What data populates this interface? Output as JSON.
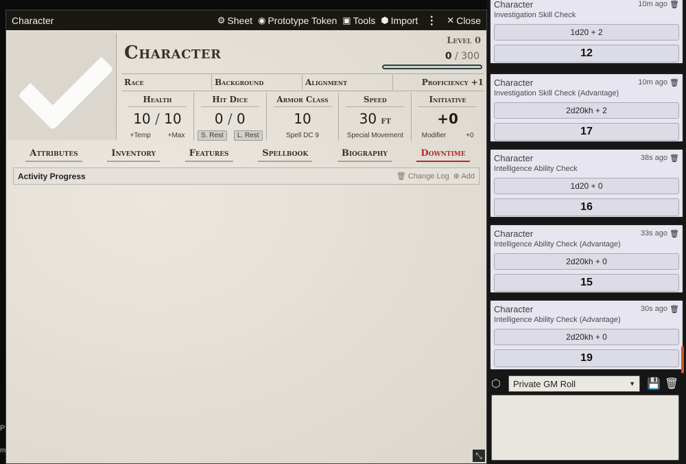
{
  "window": {
    "title": "Character",
    "buttons": [
      {
        "icon": "gear",
        "label": "Sheet"
      },
      {
        "icon": "user-circle",
        "label": "Prototype Token"
      },
      {
        "icon": "toolbox",
        "label": "Tools"
      },
      {
        "icon": "box",
        "label": "Import"
      }
    ],
    "close_label": "Close"
  },
  "character": {
    "name": "Character",
    "level_label": "Level 0",
    "xp_value": "0",
    "xp_max": "300",
    "race_label": "Race",
    "background_label": "Background",
    "alignment_label": "Alignment",
    "proficiency_label": "Proficiency +1"
  },
  "stats": {
    "health": {
      "label": "Health",
      "value": "10",
      "max": "10",
      "temp": "+Temp",
      "maxlbl": "+Max"
    },
    "hitdice": {
      "label": "Hit Dice",
      "value": "0",
      "max": "0",
      "short_rest": "S. Rest",
      "long_rest": "L. Rest"
    },
    "armor": {
      "label": "Armor Class",
      "value": "10",
      "sub": "Spell DC 9"
    },
    "speed": {
      "label": "Speed",
      "value": "30",
      "unit": "ft",
      "sub": "Special Movement"
    },
    "initiative": {
      "label": "Initiative",
      "value": "+0",
      "sub": "Modifier",
      "mod": "+0"
    }
  },
  "tabs": [
    "Attributes",
    "Inventory",
    "Features",
    "Spellbook",
    "Biography",
    "Downtime"
  ],
  "active_tab": "Downtime",
  "activity": {
    "title": "Activity Progress",
    "change_log": "Change Log",
    "add": "Add"
  },
  "edge": {
    "a": "P",
    "b": "m"
  },
  "chat": {
    "messages": [
      {
        "speaker": "Character",
        "time": "10m ago",
        "flavor": "Investigation Skill Check",
        "formula": "1d20 + 2",
        "total": "12"
      },
      {
        "speaker": "Character",
        "time": "10m ago",
        "flavor": "Investigation Skill Check (Advantage)",
        "formula": "2d20kh + 2",
        "total": "17"
      },
      {
        "speaker": "Character",
        "time": "38s ago",
        "flavor": "Intelligence Ability Check",
        "formula": "1d20 + 0",
        "total": "16"
      },
      {
        "speaker": "Character",
        "time": "33s ago",
        "flavor": "Intelligence Ability Check (Advantage)",
        "formula": "2d20kh + 0",
        "total": "15"
      },
      {
        "speaker": "Character",
        "time": "30s ago",
        "flavor": "Intelligence Ability Check (Advantage)",
        "formula": "2d20kh + 0",
        "total": "19"
      }
    ],
    "roll_mode": "Private GM Roll"
  }
}
